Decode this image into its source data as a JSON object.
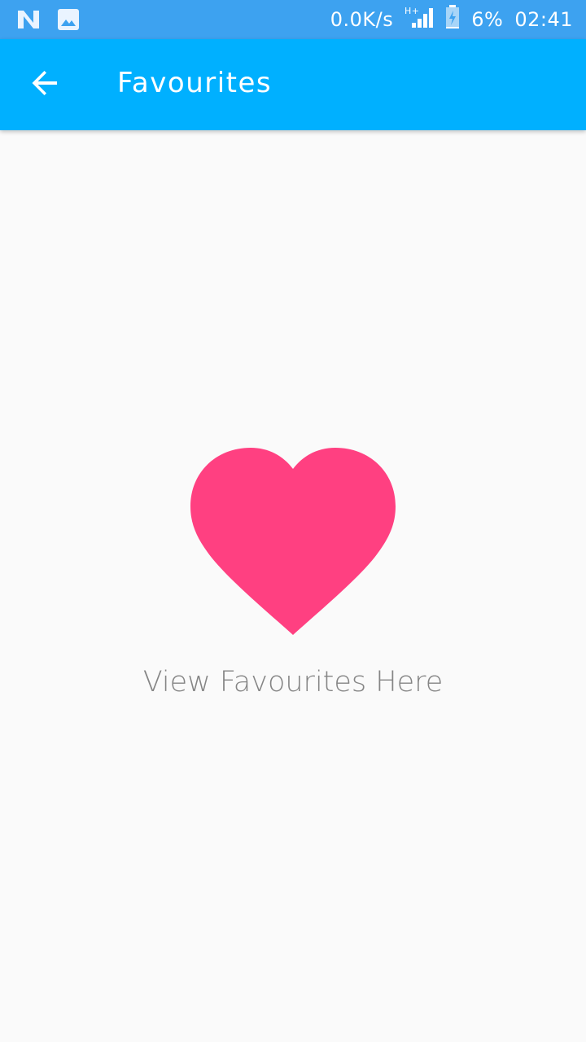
{
  "status_bar": {
    "left_icons": [
      "n-notification-icon",
      "image-notification-icon"
    ],
    "network_speed": "0.0K/s",
    "network_type_icon": "hplus-signal-icon",
    "battery_icon": "battery-charging-icon",
    "battery_percent": "6%",
    "time": "02:41"
  },
  "app_bar": {
    "back_icon": "arrow-back-icon",
    "title": "Favourites"
  },
  "empty_state": {
    "icon": "heart-icon",
    "message": "View Favourites Here"
  },
  "colors": {
    "status_bar": "#3da2f0",
    "app_bar": "#00b0ff",
    "heart": "#ff4081",
    "background": "#fafafa",
    "message_text": "#858585"
  }
}
